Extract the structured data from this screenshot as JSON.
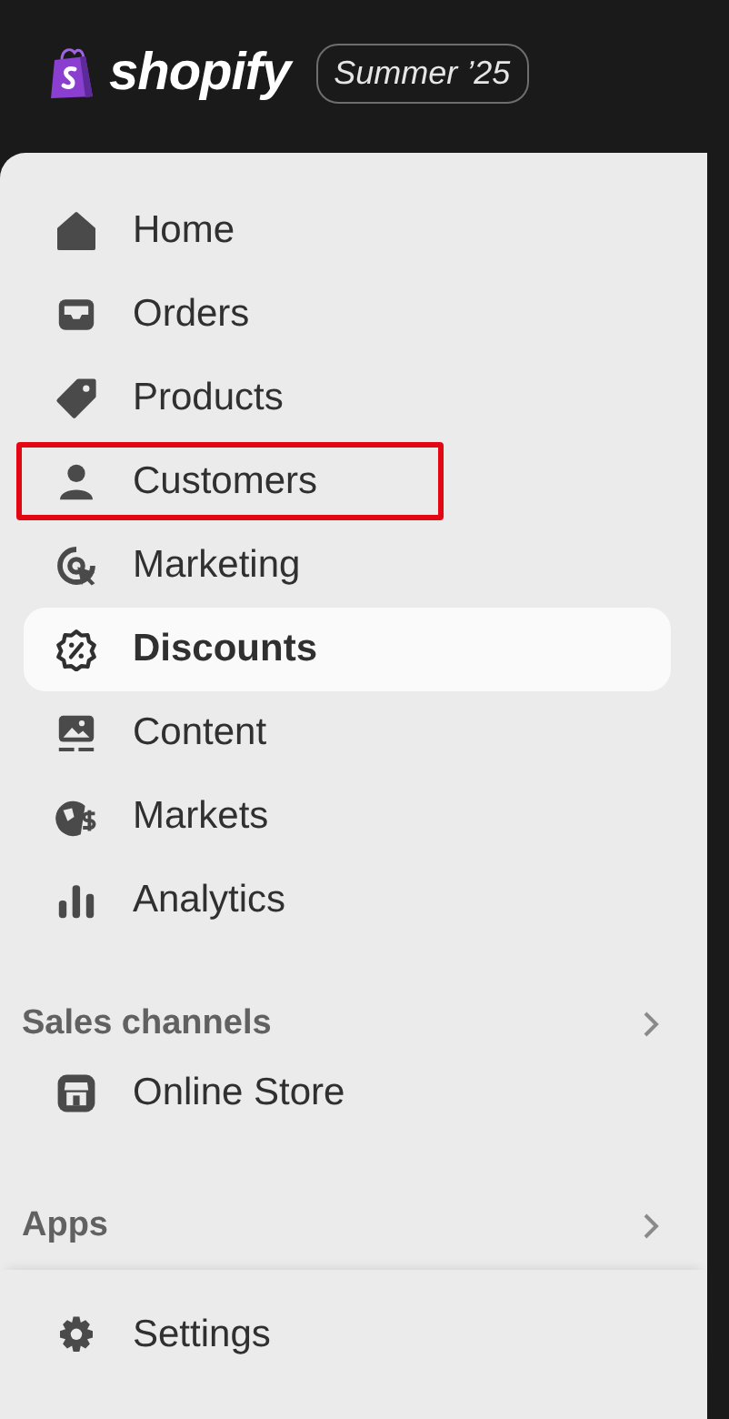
{
  "header": {
    "brand": "shopify",
    "badge": "Summer ’25"
  },
  "nav": [
    {
      "label": "Home",
      "selected": false,
      "highlighted": false
    },
    {
      "label": "Orders",
      "selected": false,
      "highlighted": false
    },
    {
      "label": "Products",
      "selected": false,
      "highlighted": false
    },
    {
      "label": "Customers",
      "selected": false,
      "highlighted": true
    },
    {
      "label": "Marketing",
      "selected": false,
      "highlighted": false
    },
    {
      "label": "Discounts",
      "selected": true,
      "highlighted": false
    },
    {
      "label": "Content",
      "selected": false,
      "highlighted": false
    },
    {
      "label": "Markets",
      "selected": false,
      "highlighted": false
    },
    {
      "label": "Analytics",
      "selected": false,
      "highlighted": false
    }
  ],
  "sales_channels": {
    "title": "Sales channels",
    "items": [
      {
        "label": "Online Store",
        "selected": false
      }
    ]
  },
  "apps": {
    "title": "Apps"
  },
  "footer": {
    "items": [
      {
        "label": "Settings",
        "selected": false
      }
    ]
  }
}
